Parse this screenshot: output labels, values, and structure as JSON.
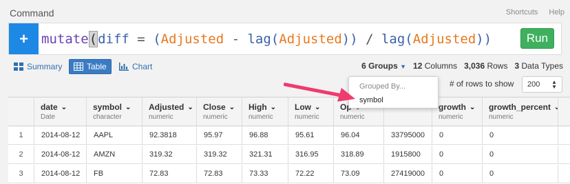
{
  "header": {
    "title": "Command",
    "links": [
      "Shortcuts",
      "Help"
    ]
  },
  "command": {
    "add_label": "+",
    "tokens": [
      {
        "t": "mutate",
        "c": "fn"
      },
      {
        "t": "(",
        "c": "cursor"
      },
      {
        "t": "diff",
        "c": "id"
      },
      {
        "t": " = ",
        "c": "op"
      },
      {
        "t": "(",
        "c": "id"
      },
      {
        "t": "Adjusted",
        "c": "col"
      },
      {
        "t": " - ",
        "c": "op"
      },
      {
        "t": "lag(",
        "c": "id"
      },
      {
        "t": "Adjusted",
        "c": "col"
      },
      {
        "t": "))",
        "c": "id"
      },
      {
        "t": " / ",
        "c": "op"
      },
      {
        "t": "lag(",
        "c": "id"
      },
      {
        "t": "Adjusted",
        "c": "col"
      },
      {
        "t": "))",
        "c": "id"
      }
    ],
    "run_label": "Run"
  },
  "tabs": {
    "summary": "Summary",
    "table": "Table",
    "chart": "Chart"
  },
  "stats": {
    "groups": "6 Groups",
    "columns_count": "12",
    "columns_label": "Columns",
    "rows_count": "3,036",
    "rows_label": "Rows",
    "types_count": "3",
    "types_label": "Data Types"
  },
  "rows_per_page": {
    "label": "# of rows to show",
    "value": "200"
  },
  "group_dropdown": {
    "header": "Grouped By...",
    "item": "symbol"
  },
  "table": {
    "columns": [
      {
        "name": "date",
        "type": "Date"
      },
      {
        "name": "symbol",
        "type": "character"
      },
      {
        "name": "Adjusted",
        "type": "numeric"
      },
      {
        "name": "Close",
        "type": "numeric"
      },
      {
        "name": "High",
        "type": "numeric"
      },
      {
        "name": "Low",
        "type": "numeric"
      },
      {
        "name": "Op",
        "type": "numeric"
      },
      {
        "name": "",
        "type": ""
      },
      {
        "name": "growth",
        "type": "numeric"
      },
      {
        "name": "growth_percent",
        "type": "numeric"
      }
    ],
    "rows": [
      [
        "1",
        "2014-08-12",
        "AAPL",
        "92.3818",
        "95.97",
        "96.88",
        "95.61",
        "96.04",
        "33795000",
        "0",
        "0"
      ],
      [
        "2",
        "2014-08-12",
        "AMZN",
        "319.32",
        "319.32",
        "321.31",
        "316.95",
        "318.89",
        "1915800",
        "0",
        "0"
      ],
      [
        "3",
        "2014-08-12",
        "FB",
        "72.83",
        "72.83",
        "73.33",
        "72.22",
        "73.09",
        "27419000",
        "0",
        "0"
      ]
    ]
  }
}
